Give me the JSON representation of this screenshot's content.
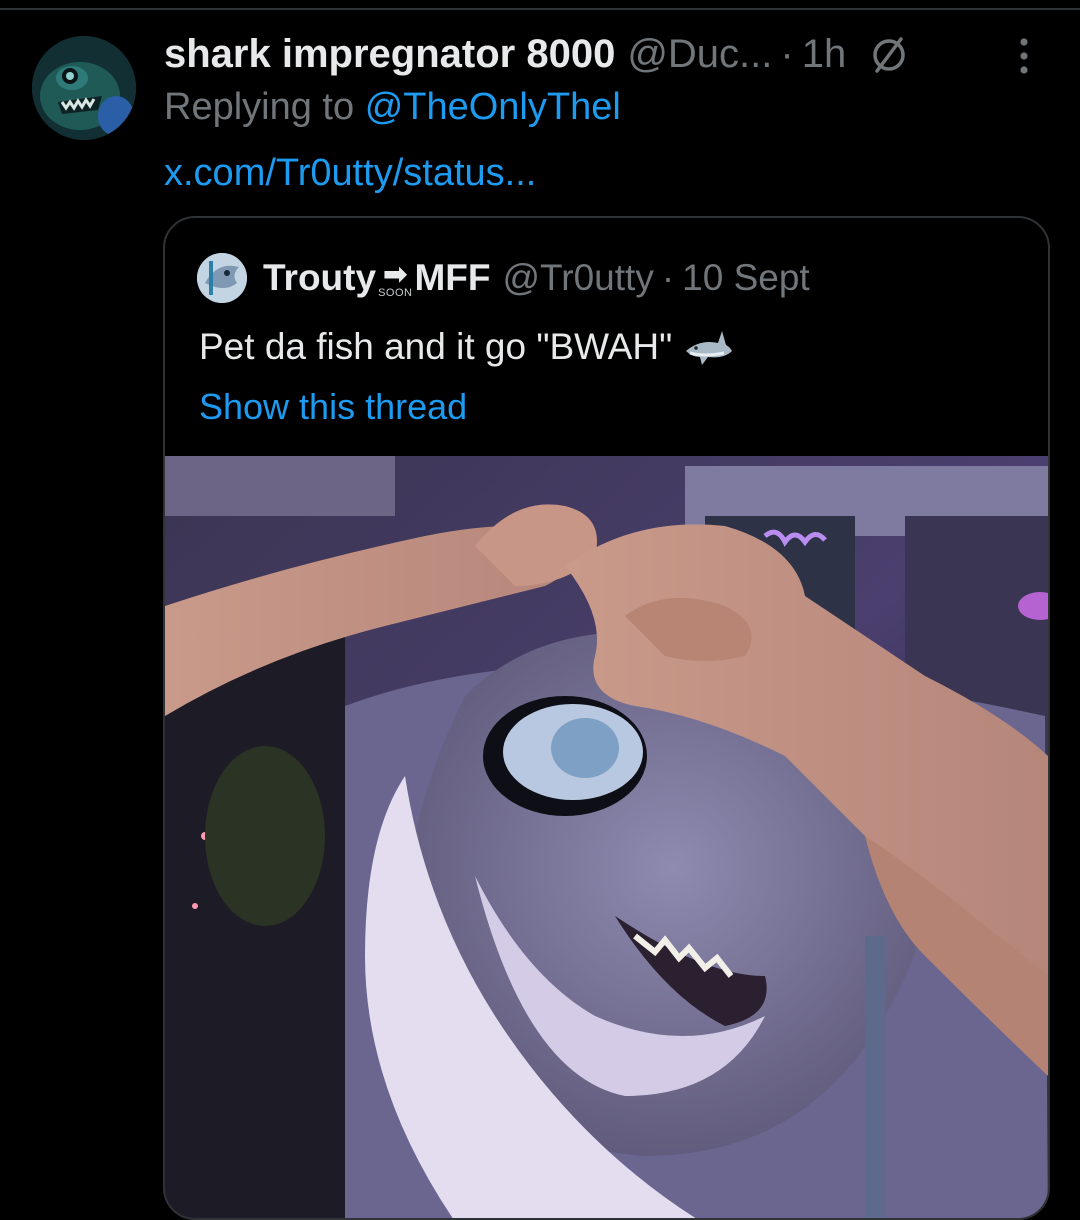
{
  "tweet": {
    "display_name": "shark impregnator 8000",
    "handle": "@Duc...",
    "separator": "·",
    "time": "1h",
    "replying_prefix": "Replying to",
    "replying_to": "@TheOnlyThel",
    "link_text": "x.com/Tr0utty/status..."
  },
  "quoted_tweet": {
    "display_name_part1": "Trouty",
    "arrow_glyph": "➡",
    "arrow_caption": "SOON",
    "display_name_part2": "MFF",
    "handle": "@Tr0utty",
    "separator": "·",
    "date": "10 Sept",
    "text": "Pet da fish and it go \"BWAH\"",
    "emoji": "shark-emoji",
    "show_thread": "Show this thread"
  },
  "icons": {
    "verified_slash": "null-circle-icon",
    "more": "more-dots-icon"
  },
  "colors": {
    "background": "#000000",
    "primary_text": "#e7e9ea",
    "secondary_text": "#71767b",
    "link": "#1d9bf0",
    "border": "#2f3336"
  }
}
